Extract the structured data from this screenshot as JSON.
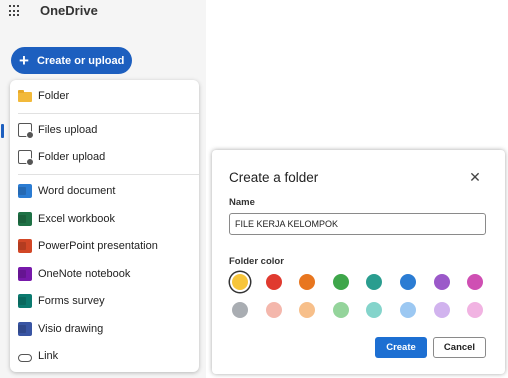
{
  "app": {
    "title": "OneDrive"
  },
  "create_button": {
    "label": "Create or upload",
    "icon": "plus-icon"
  },
  "menu": {
    "items": [
      {
        "label": "Folder",
        "icon": "folder-icon"
      },
      {
        "label": "Files upload",
        "icon": "file-upload-icon"
      },
      {
        "label": "Folder upload",
        "icon": "folder-upload-icon"
      },
      {
        "label": "Word document",
        "icon": "word-icon"
      },
      {
        "label": "Excel workbook",
        "icon": "excel-icon"
      },
      {
        "label": "PowerPoint presentation",
        "icon": "powerpoint-icon"
      },
      {
        "label": "OneNote notebook",
        "icon": "onenote-icon"
      },
      {
        "label": "Forms survey",
        "icon": "forms-icon"
      },
      {
        "label": "Visio drawing",
        "icon": "visio-icon"
      },
      {
        "label": "Link",
        "icon": "link-icon"
      }
    ]
  },
  "dialog": {
    "title": "Create a folder",
    "close_icon": "close-icon",
    "name_label": "Name",
    "name_value": "FILE KERJA KELOMPOK",
    "color_label": "Folder color",
    "colors_row1": [
      "#f7c53b",
      "#e03a2f",
      "#e8761f",
      "#3ea64a",
      "#2a9d8f",
      "#2b7cd3",
      "#9b59c9",
      "#cf4fb3"
    ],
    "colors_row2": [
      "#a9adb2",
      "#f4b7ac",
      "#f7bf8a",
      "#94d49b",
      "#84d4cb",
      "#9cc8f2",
      "#d1b3ee",
      "#f1b3e2"
    ],
    "selected_color_index": 0,
    "create_label": "Create",
    "cancel_label": "Cancel"
  }
}
